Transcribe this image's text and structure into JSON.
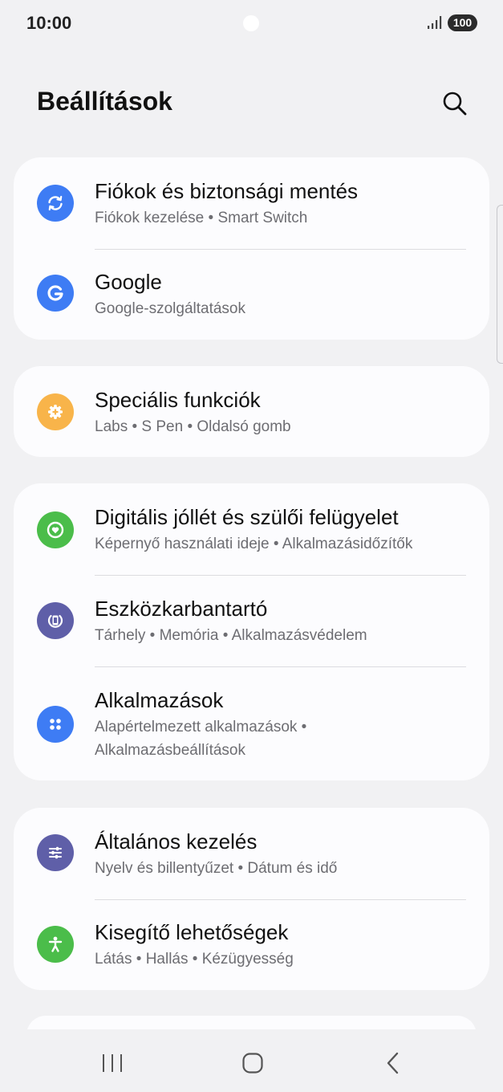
{
  "status_bar": {
    "time": "10:00",
    "battery": "100"
  },
  "header": {
    "title": "Beállítások"
  },
  "cards": [
    {
      "items": [
        {
          "title": "Fiókok és biztonsági mentés",
          "subtitle": "Fiókok kezelése  •  Smart Switch",
          "icon": "sync-icon",
          "color": "#3e7cf4"
        },
        {
          "title": "Google",
          "subtitle": "Google-szolgáltatások",
          "icon": "google-icon",
          "color": "#3e7cf4"
        }
      ]
    },
    {
      "items": [
        {
          "title": "Speciális funkciók",
          "subtitle": "Labs  •  S Pen  •  Oldalsó gomb",
          "icon": "gear-plus-icon",
          "color": "#f8b44a"
        }
      ]
    },
    {
      "items": [
        {
          "title": "Digitális jóllét és szülői felügyelet",
          "subtitle": "Képernyő használati ideje  •  Alkalmazásidőzítők",
          "icon": "heart-circle-icon",
          "color": "#4bbd4a"
        },
        {
          "title": "Eszközkarbantartó",
          "subtitle": "Tárhely  •  Memória  •  Alkalmazásvédelem",
          "icon": "device-care-icon",
          "color": "#5f5fa8"
        },
        {
          "title": "Alkalmazások",
          "subtitle": "Alapértelmezett alkalmazások  •  Alkalmazásbeállítások",
          "icon": "apps-grid-icon",
          "color": "#3e7cf4"
        }
      ]
    },
    {
      "items": [
        {
          "title": "Általános kezelés",
          "subtitle": "Nyelv és billentyűzet  •  Dátum és idő",
          "icon": "sliders-icon",
          "color": "#5f5fa8"
        },
        {
          "title": "Kisegítő lehetőségek",
          "subtitle": "Látás  •  Hallás  •  Kézügyesség",
          "icon": "accessibility-icon",
          "color": "#4bbd4a"
        }
      ]
    }
  ]
}
